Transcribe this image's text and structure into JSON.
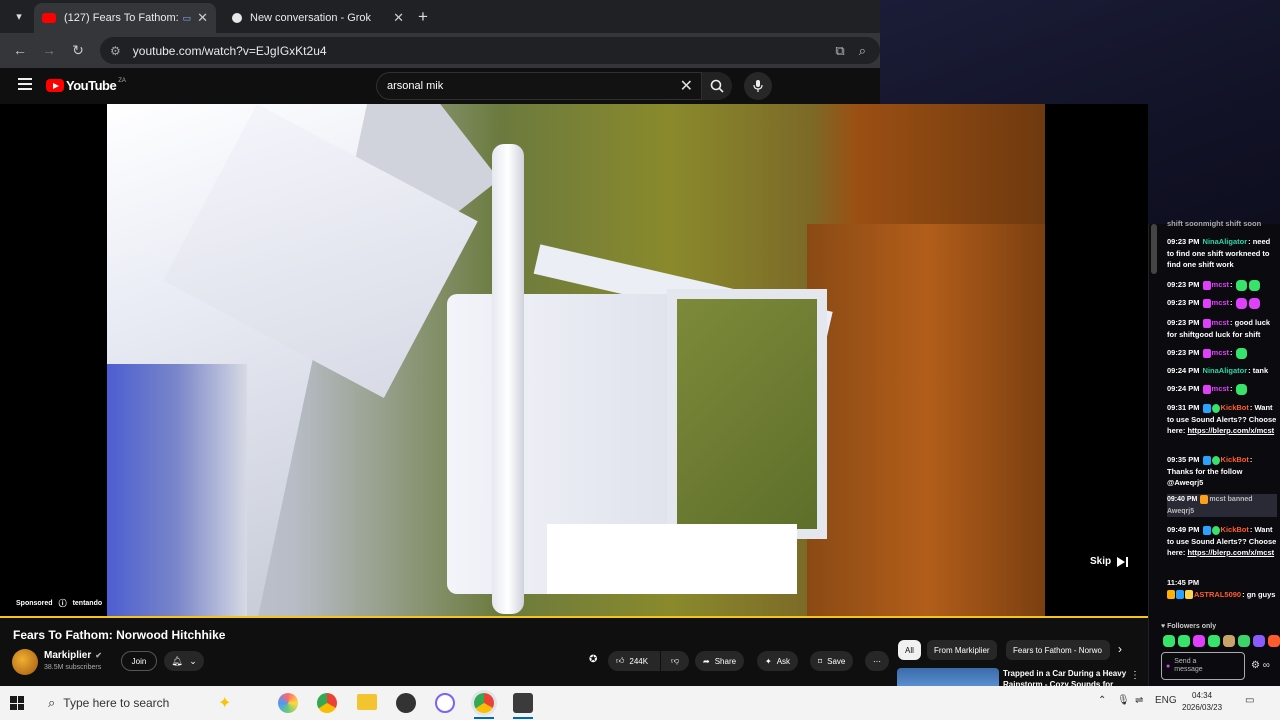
{
  "browser": {
    "tabs": [
      {
        "title": "(127) Fears To Fathom: Nor",
        "active": true
      },
      {
        "title": "New conversation - Grok",
        "active": false
      }
    ],
    "new_tab": "+",
    "url": "youtube.com/watch?v=EJgIGxKt2u4"
  },
  "youtube": {
    "logo": "YouTube",
    "country": "ZA",
    "search_query": "arsonal mik"
  },
  "player": {
    "skip_label": "Skip",
    "sponsored_label": "Sponsored",
    "advertiser": "tentando",
    "progress_color": "#f5c518"
  },
  "video": {
    "title": "Fears To Fathom: Norwood Hitchhike",
    "channel": "Markiplier",
    "subscribers": "38.5M subscribers",
    "join_label": "Join",
    "likes": "244K",
    "share_label": "Share",
    "ask_label": "Ask",
    "save_label": "Save"
  },
  "chips": [
    "All",
    "From Markiplier",
    "Fears to Fathom - Norwo"
  ],
  "recommendation": {
    "title": "Trapped in a Car During a Heavy Rainstorm - Cozy Sounds for"
  },
  "chat": {
    "top_fragment": "shift soonmight shift soon",
    "messages": [
      {
        "time": "09:23 PM",
        "user": "NinaAligator",
        "user_color": "#2fd4a8",
        "text": "need to find one shift workneed to find one shift work"
      },
      {
        "time": "09:23 PM",
        "user": "mcst",
        "user_color": "#e040fb",
        "text": ""
      },
      {
        "time": "09:23 PM",
        "user": "mcst",
        "user_color": "#e040fb",
        "text": ""
      },
      {
        "time": "09:23 PM",
        "user": "mcst",
        "user_color": "#e040fb",
        "text": "good luck for shiftgood luck for shift"
      },
      {
        "time": "09:23 PM",
        "user": "mcst",
        "user_color": "#e040fb",
        "text": ""
      },
      {
        "time": "09:24 PM",
        "user": "NinaAligator",
        "user_color": "#2fd4a8",
        "text": "tank"
      },
      {
        "time": "09:24 PM",
        "user": "mcst",
        "user_color": "#e040fb",
        "text": ""
      },
      {
        "time": "09:31 PM",
        "user": "KickBot",
        "user_color": "#ff5b2e",
        "text": "Want to use Sound Alerts?? Choose here:",
        "link": "https://blerp.com/x/mcst"
      },
      {
        "time": "09:35 PM",
        "user": "KickBot",
        "user_color": "#ff5b2e",
        "text": "Thanks for the follow @Aweqrj5"
      },
      {
        "time": "09:40 PM",
        "user": "",
        "user_color": "#ff9f1a",
        "text": "mcst banned Aweqrj5"
      },
      {
        "time": "09:49 PM",
        "user": "KickBot",
        "user_color": "#ff5b2e",
        "text": "Want to use Sound Alerts?? Choose here:",
        "link": "https://blerp.com/x/mcst"
      },
      {
        "time": "11:45 PM",
        "user": "ASTRAL5090",
        "user_color": "#ff5b2e",
        "text": "gn guys"
      }
    ],
    "followers_only": "Followers only",
    "send_placeholder": "Send a message"
  },
  "taskbar": {
    "search_placeholder": "Type here to search",
    "language": "ENG",
    "time": "04:34",
    "date": "2026/03/23"
  },
  "colors": {
    "chrome_dark": "#202124",
    "youtube_red": "#ff0000",
    "chat_bg": "#0b0b0f",
    "taskbar_bg": "#f3f3f3"
  }
}
